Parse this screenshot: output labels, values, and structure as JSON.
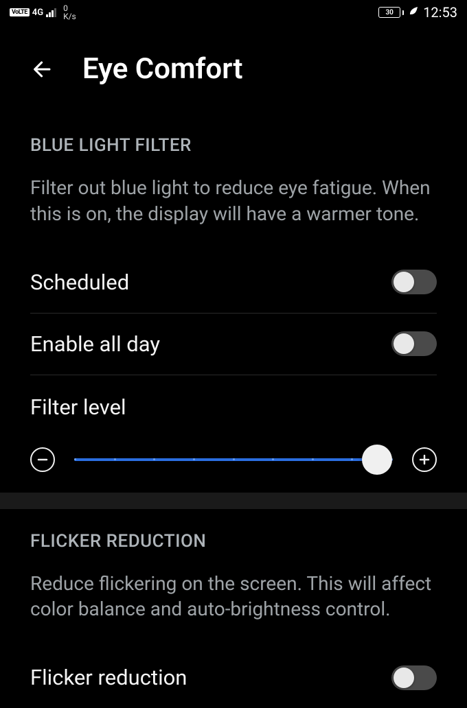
{
  "status": {
    "volte": "VoLTE",
    "network": "4G",
    "speed_value": "0",
    "speed_unit": "K/s",
    "battery": "30",
    "time": "12:53"
  },
  "header": {
    "title": "Eye Comfort"
  },
  "blue_light": {
    "section_title": "BLUE LIGHT FILTER",
    "description": "Filter out blue light to reduce eye fatigue. When this is on, the display will have a warmer tone.",
    "scheduled_label": "Scheduled",
    "enable_all_day_label": "Enable all day",
    "filter_level_label": "Filter level"
  },
  "flicker": {
    "section_title": "FLICKER REDUCTION",
    "description": "Reduce flickering on the screen. This will affect color balance and auto-brightness control.",
    "flicker_reduction_label": "Flicker reduction"
  }
}
